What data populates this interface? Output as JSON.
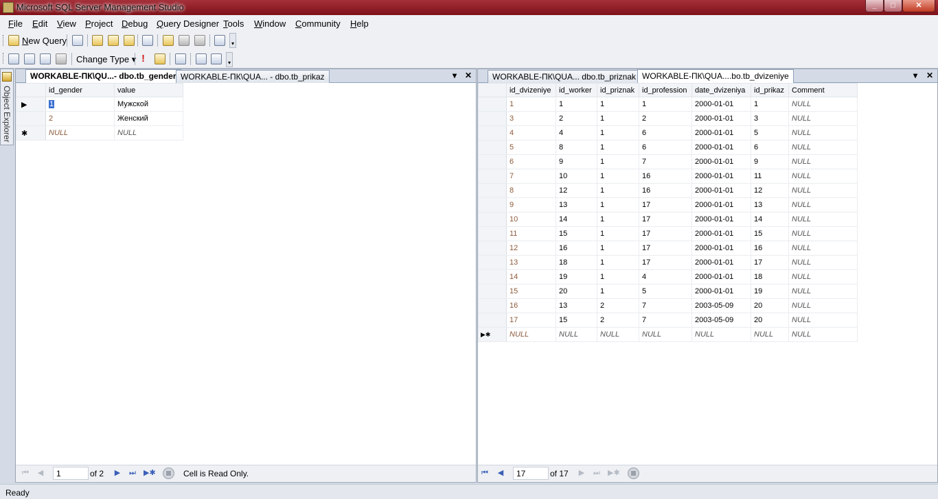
{
  "window": {
    "title": "Microsoft SQL Server Management Studio"
  },
  "menu": [
    {
      "label": "File",
      "u": "F",
      "rest": "ile"
    },
    {
      "label": "Edit",
      "u": "E",
      "rest": "dit"
    },
    {
      "label": "View",
      "u": "V",
      "rest": "iew"
    },
    {
      "label": "Project",
      "u": "P",
      "rest": "roject"
    },
    {
      "label": "Debug",
      "u": "D",
      "rest": "ebug"
    },
    {
      "label": "Query Designer",
      "u": "Q",
      "rest": "uery Designer"
    },
    {
      "label": "Tools",
      "u": "T",
      "rest": "ools"
    },
    {
      "label": "Window",
      "u": "W",
      "rest": "indow"
    },
    {
      "label": "Community",
      "u": "C",
      "rest": "ommunity"
    },
    {
      "label": "Help",
      "u": "H",
      "rest": "elp"
    }
  ],
  "toolbar": {
    "new_query_u": "N",
    "new_query_rest": "ew Query",
    "change_type": "Change Type",
    "dropdown_glyph": "▾"
  },
  "object_explorer": {
    "label": "Object Explorer"
  },
  "left_pane": {
    "tabs": [
      "WORKABLE-ПК\\QU...- dbo.tb_gender",
      "WORKABLE-ПК\\QUA... - dbo.tb_prikaz"
    ],
    "columns": [
      "id_gender",
      "value"
    ],
    "rows": [
      [
        "1",
        "Мужской"
      ],
      [
        "2",
        "Женский"
      ]
    ],
    "new_row": [
      "NULL",
      "NULL"
    ],
    "nav": {
      "position": "1",
      "of": "of 2",
      "status": "Cell is Read Only."
    }
  },
  "right_pane": {
    "tabs": [
      "WORKABLE-ПК\\QUA... dbo.tb_priznak",
      "WORKABLE-ПК\\QUA....bo.tb_dvizeniye"
    ],
    "columns": [
      "id_dvizeniye",
      "id_worker",
      "id_priznak",
      "id_profession",
      "date_dvizeniya",
      "id_prikaz",
      "Comment"
    ],
    "rows": [
      [
        "1",
        "1",
        "1",
        "1",
        "2000-01-01",
        "1",
        "NULL"
      ],
      [
        "3",
        "2",
        "1",
        "2",
        "2000-01-01",
        "3",
        "NULL"
      ],
      [
        "4",
        "4",
        "1",
        "6",
        "2000-01-01",
        "5",
        "NULL"
      ],
      [
        "5",
        "8",
        "1",
        "6",
        "2000-01-01",
        "6",
        "NULL"
      ],
      [
        "6",
        "9",
        "1",
        "7",
        "2000-01-01",
        "9",
        "NULL"
      ],
      [
        "7",
        "10",
        "1",
        "16",
        "2000-01-01",
        "11",
        "NULL"
      ],
      [
        "8",
        "12",
        "1",
        "16",
        "2000-01-01",
        "12",
        "NULL"
      ],
      [
        "9",
        "13",
        "1",
        "17",
        "2000-01-01",
        "13",
        "NULL"
      ],
      [
        "10",
        "14",
        "1",
        "17",
        "2000-01-01",
        "14",
        "NULL"
      ],
      [
        "11",
        "15",
        "1",
        "17",
        "2000-01-01",
        "15",
        "NULL"
      ],
      [
        "12",
        "16",
        "1",
        "17",
        "2000-01-01",
        "16",
        "NULL"
      ],
      [
        "13",
        "18",
        "1",
        "17",
        "2000-01-01",
        "17",
        "NULL"
      ],
      [
        "14",
        "19",
        "1",
        "4",
        "2000-01-01",
        "18",
        "NULL"
      ],
      [
        "15",
        "20",
        "1",
        "5",
        "2000-01-01",
        "19",
        "NULL"
      ],
      [
        "16",
        "13",
        "2",
        "7",
        "2003-05-09",
        "20",
        "NULL"
      ],
      [
        "17",
        "15",
        "2",
        "7",
        "2003-05-09",
        "20",
        "NULL"
      ]
    ],
    "new_row": [
      "NULL",
      "NULL",
      "NULL",
      "NULL",
      "NULL",
      "NULL",
      "NULL"
    ],
    "nav": {
      "position": "17",
      "of": "of 17"
    }
  },
  "status": {
    "text": "Ready"
  }
}
